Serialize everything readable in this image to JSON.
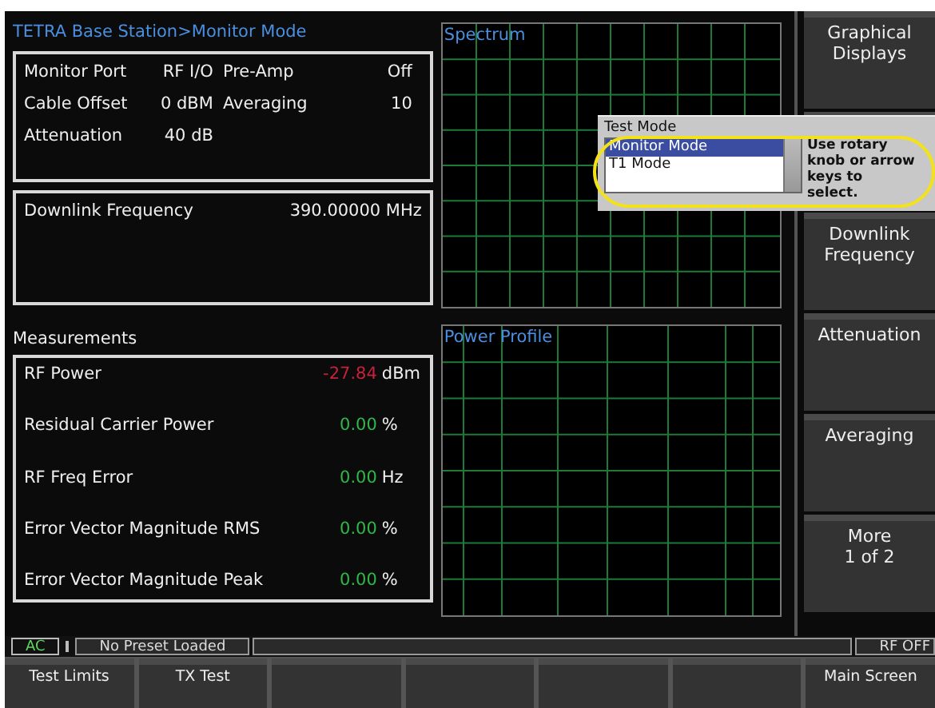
{
  "header": {
    "title": "TETRA Base Station>Monitor Mode"
  },
  "settings": [
    {
      "label": "Monitor Port",
      "value": "RF I/O"
    },
    {
      "label": "Pre-Amp",
      "value": "Off"
    },
    {
      "label": "Cable Offset",
      "value": "0  dBM"
    },
    {
      "label": "Averaging",
      "value": "10"
    },
    {
      "label": "Attenuation",
      "value": "40 dB"
    }
  ],
  "downlink": {
    "label": "Downlink Frequency",
    "value": "390.00000 MHz"
  },
  "measurements": {
    "title": "Measurements",
    "rows": [
      {
        "label": "RF Power",
        "value": "-27.84",
        "unit": "dBm",
        "color": "#c8213a"
      },
      {
        "label": "Residual Carrier Power",
        "value": "0.00",
        "unit": "%",
        "color": "#2fb84a"
      },
      {
        "label": "RF Freq Error",
        "value": "0.00",
        "unit": "Hz",
        "color": "#2fb84a"
      },
      {
        "label": "Error Vector Magnitude RMS",
        "value": "0.00",
        "unit": "%",
        "color": "#2fb84a"
      },
      {
        "label": "Error Vector Magnitude Peak",
        "value": "0.00",
        "unit": "%",
        "color": "#2fb84a"
      }
    ]
  },
  "charts": [
    {
      "title": "Spectrum"
    },
    {
      "title": "Power Profile"
    }
  ],
  "softkeys": [
    {
      "kind": "label",
      "label": "Graphical\nDisplays"
    },
    {
      "kind": "blank"
    },
    {
      "kind": "label",
      "label": "Downlink\nFrequency"
    },
    {
      "kind": "label",
      "label": "Attenuation"
    },
    {
      "kind": "label",
      "label": "Averaging"
    },
    {
      "kind": "label",
      "label": "More\n1 of 2"
    }
  ],
  "popup": {
    "title": "Test Mode",
    "items": [
      {
        "label": "Monitor Mode",
        "selected": true
      },
      {
        "label": "T1 Mode",
        "selected": false
      }
    ],
    "hint": "Use rotary knob or arrow keys to select."
  },
  "status_bar": {
    "power": "AC",
    "preset": "No Preset Loaded",
    "rf": "RF OFF"
  },
  "bottom_keys": [
    {
      "kind": "label",
      "label": "Test Limits"
    },
    {
      "kind": "label",
      "label": "TX Test"
    },
    {
      "kind": "blank"
    },
    {
      "kind": "blank"
    },
    {
      "kind": "blank"
    },
    {
      "kind": "blank"
    },
    {
      "kind": "label",
      "label": "Main Screen"
    }
  ]
}
